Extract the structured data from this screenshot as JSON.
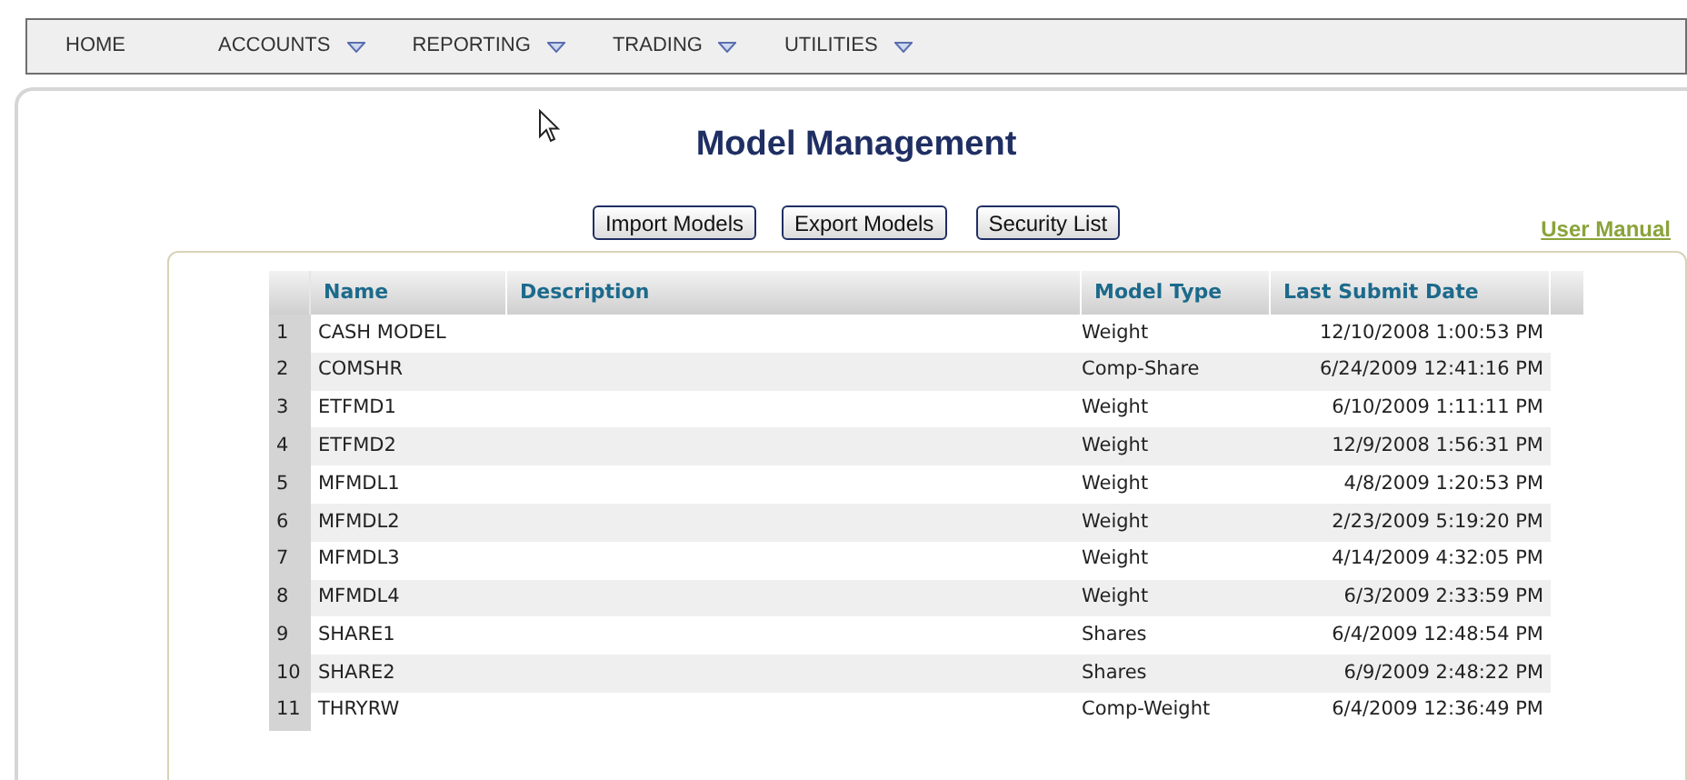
{
  "nav": {
    "items": [
      {
        "label": "HOME",
        "has_menu": false
      },
      {
        "label": "ACCOUNTS",
        "has_menu": true
      },
      {
        "label": "REPORTING",
        "has_menu": true
      },
      {
        "label": "TRADING",
        "has_menu": true
      },
      {
        "label": "UTILITIES",
        "has_menu": true
      }
    ]
  },
  "title": "Model Management",
  "buttons": [
    "Import Models",
    "Export Models",
    "Security List"
  ],
  "user_manual_link": "User Manual",
  "table": {
    "columns": [
      "Name",
      "Description",
      "Model Type",
      "Last Submit Date"
    ],
    "rows": [
      {
        "index": "1",
        "name": "CASH MODEL",
        "model_type": "Weight",
        "last_submit_date": "12/10/2008 1:00:53 PM"
      },
      {
        "index": "2",
        "name": "COMSHR",
        "model_type": "Comp-Share",
        "last_submit_date": "6/24/2009 12:41:16 PM"
      },
      {
        "index": "3",
        "name": "ETFMD1",
        "model_type": "Weight",
        "last_submit_date": "6/10/2009 1:11:11 PM"
      },
      {
        "index": "4",
        "name": "ETFMD2",
        "model_type": "Weight",
        "last_submit_date": "12/9/2008 1:56:31 PM"
      },
      {
        "index": "5",
        "name": "MFMDL1",
        "model_type": "Weight",
        "last_submit_date": "4/8/2009 1:20:53 PM"
      },
      {
        "index": "6",
        "name": "MFMDL2",
        "model_type": "Weight",
        "last_submit_date": "2/23/2009 5:19:20 PM"
      },
      {
        "index": "7",
        "name": "MFMDL3",
        "model_type": "Weight",
        "last_submit_date": "4/14/2009 4:32:05 PM"
      },
      {
        "index": "8",
        "name": "MFMDL4",
        "model_type": "Weight",
        "last_submit_date": "6/3/2009 2:33:59 PM"
      },
      {
        "index": "9",
        "name": "SHARE1",
        "model_type": "Shares",
        "last_submit_date": "6/4/2009 12:48:54 PM"
      },
      {
        "index": "10",
        "name": "SHARE2",
        "model_type": "Shares",
        "last_submit_date": "6/9/2009 2:48:22 PM"
      },
      {
        "index": "11",
        "name": "THRYRW",
        "model_type": "Comp-Weight",
        "last_submit_date": "6/4/2009 12:36:49 PM"
      }
    ]
  }
}
